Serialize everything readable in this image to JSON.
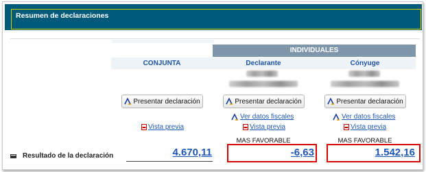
{
  "panel": {
    "title": "Resumen de declaraciones"
  },
  "columns": {
    "group_header": "INDIVIDUALES",
    "conjunta": "CONJUNTA",
    "declarante": "Declarante",
    "conyuge": "Cónyuge"
  },
  "buttons": {
    "presentar": "Presentar declaración"
  },
  "links": {
    "ver_datos_fiscales": "Ver datos fiscales",
    "vista_previa": "Vista previa"
  },
  "labels": {
    "mas_favorable": "MAS FAVORABLE"
  },
  "result": {
    "label": "Resultado de la declaración",
    "conjunta": "4.670,11",
    "declarante": "-6,63",
    "conyuge": "1.542,16"
  },
  "colors": {
    "header_bg": "#005a7a",
    "header_border": "#d6d000",
    "group_header_bg": "#7f96aa",
    "link": "#1f57b8",
    "highlight_box": "#d50000"
  }
}
